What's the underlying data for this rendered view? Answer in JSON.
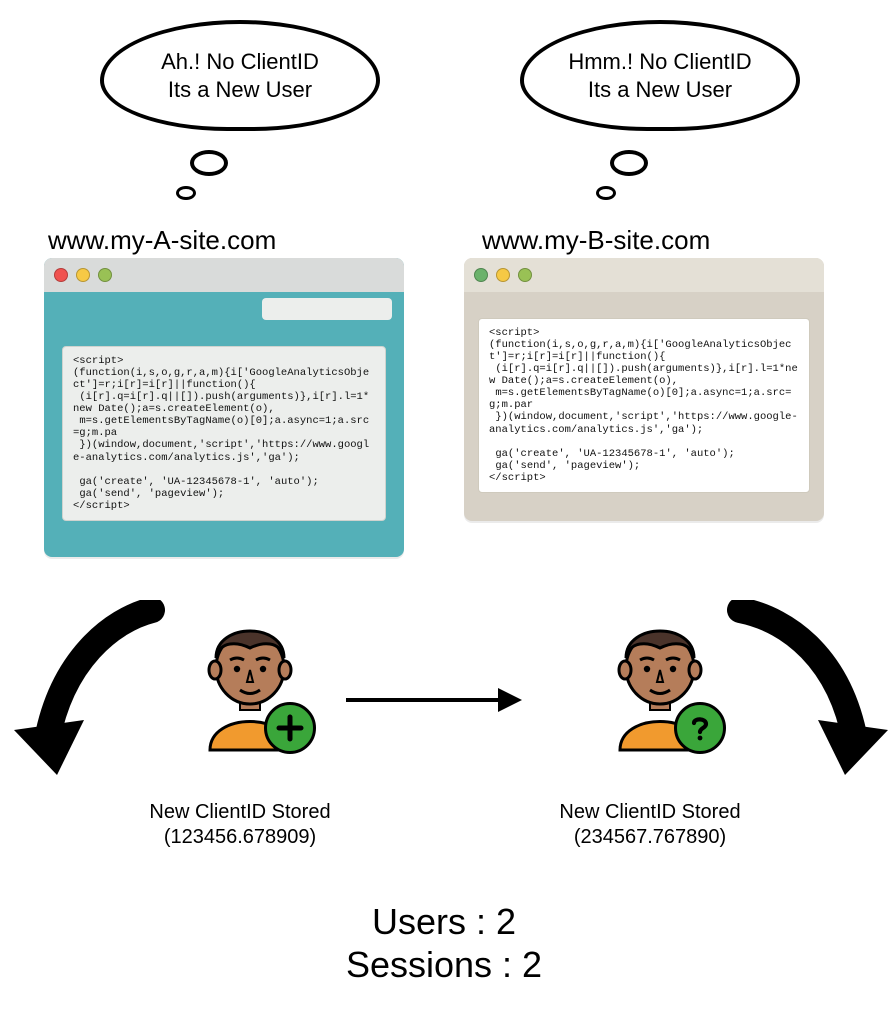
{
  "thoughts": {
    "a": {
      "line1": "Ah.! No ClientID",
      "line2": "Its a New User"
    },
    "b": {
      "line1": "Hmm.! No ClientID",
      "line2": "Its a New User"
    }
  },
  "sites": {
    "a": "www.my-A-site.com",
    "b": "www.my-B-site.com"
  },
  "code": {
    "a": "<script>\n(function(i,s,o,g,r,a,m){i['GoogleAnalyticsObject']=r;i[r]=i[r]||function(){\n (i[r].q=i[r].q||[]).push(arguments)},i[r].l=1*new Date();a=s.createElement(o),\n m=s.getElementsByTagName(o)[0];a.async=1;a.src=g;m.pa\n })(window,document,'script','https://www.google-analytics.com/analytics.js','ga');\n\n ga('create', 'UA-12345678-1', 'auto');\n ga('send', 'pageview');\n</script>",
    "b": "<script>\n(function(i,s,o,g,r,a,m){i['GoogleAnalyticsObject']=r;i[r]=i[r]||function(){\n (i[r].q=i[r].q||[]).push(arguments)},i[r].l=1*new Date();a=s.createElement(o),\n m=s.getElementsByTagName(o)[0];a.async=1;a.src=g;m.par\n })(window,document,'script','https://www.google-analytics.com/analytics.js','ga');\n\n ga('create', 'UA-12345678-1', 'auto');\n ga('send', 'pageview');\n</script>"
  },
  "captions": {
    "a": {
      "line1": "New ClientID Stored",
      "line2": "(123456.678909)"
    },
    "b": {
      "line1": "New ClientID Stored",
      "line2": "(234567.767890)"
    }
  },
  "summary": {
    "users": "Users : 2",
    "sessions": "Sessions : 2"
  },
  "colors": {
    "teal": "#54b0b8",
    "beige": "#d7d1c6",
    "badge": "#3aa63a",
    "hair": "#4a332a",
    "skin": "#b57d5a",
    "shirt": "#f19a2e"
  }
}
